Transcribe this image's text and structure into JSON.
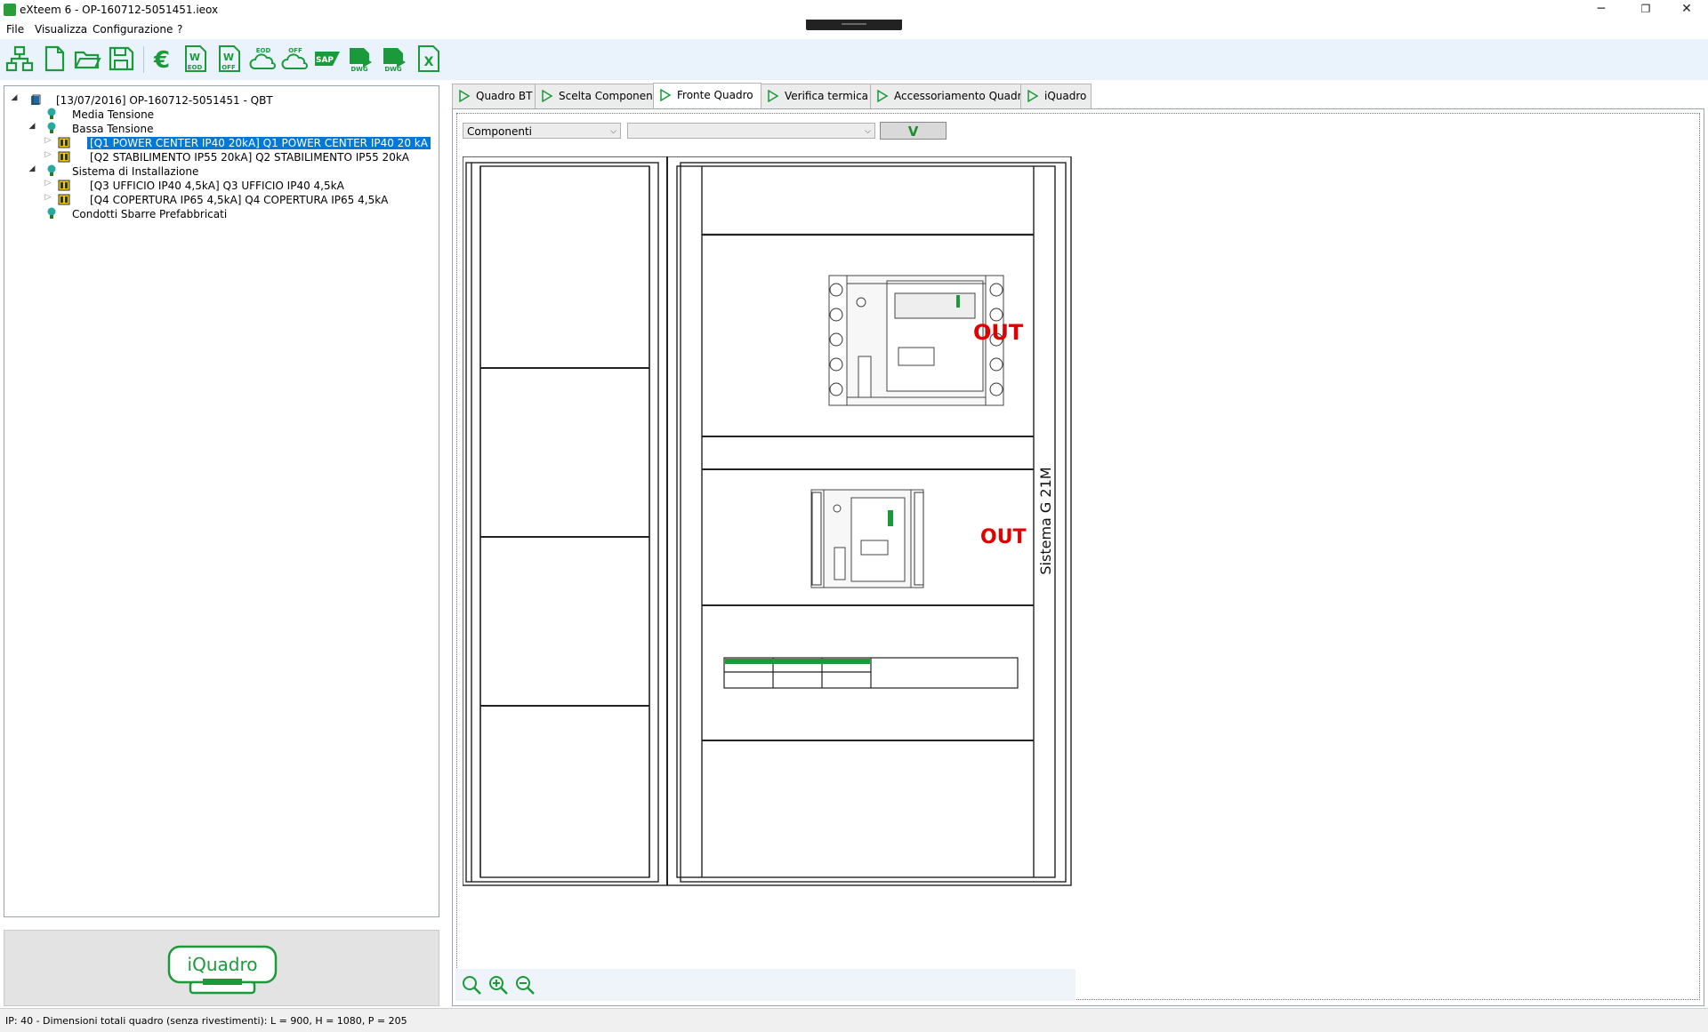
{
  "window": {
    "title": "eXteem 6 - OP-160712-5051451.ieox",
    "controls": {
      "minimize": "─",
      "restore": "❐",
      "close": "✕"
    }
  },
  "menu": {
    "items": [
      "File",
      "Visualizza",
      "Configurazione",
      "?"
    ]
  },
  "toolbar": {
    "buttons": [
      {
        "icon": "structure-icon"
      },
      {
        "icon": "new-document-icon"
      },
      {
        "icon": "open-folder-icon"
      },
      {
        "icon": "save-icon"
      },
      {
        "icon": "euro-icon",
        "text": "€"
      },
      {
        "icon": "word-eod-icon",
        "text": "EOD"
      },
      {
        "icon": "word-off-icon",
        "text": "OFF"
      },
      {
        "icon": "cloud-eod-icon",
        "text": "EOD"
      },
      {
        "icon": "cloud-off-icon",
        "text": "OFF"
      },
      {
        "icon": "sap-icon",
        "text": "SAP"
      },
      {
        "icon": "dwg-export-icon",
        "text": "DWG"
      },
      {
        "icon": "dwg-export-2-icon",
        "text": "DWG"
      },
      {
        "icon": "excel-icon",
        "text": "X"
      }
    ],
    "accent": "#1a9a3a"
  },
  "tree": {
    "root": "[13/07/2016] OP-160712-5051451 - QBT",
    "media_tensione": "Media Tensione",
    "bassa_tensione": "Bassa Tensione",
    "q1": "[Q1 POWER CENTER IP40 20kA] Q1 POWER CENTER IP40 20 kA",
    "q2": "[Q2 STABILIMENTO IP55 20kA] Q2 STABILIMENTO IP55 20kA",
    "sistema": "Sistema di Installazione",
    "q3": "[Q3 UFFICIO IP40 4,5kA] Q3 UFFICIO IP40 4,5kA",
    "q4": "[Q4 COPERTURA IP65 4,5kA] Q4 COPERTURA IP65 4,5kA",
    "condotti": "Condotti Sbarre Prefabbricati"
  },
  "logo": {
    "text": "iQuadro"
  },
  "tabs": [
    "Quadro BT",
    "Scelta Componenti",
    "Fronte Quadro",
    "Verifica termica",
    "Accessoriamento Quadro",
    "iQuadro"
  ],
  "active_tab": "Fronte Quadro",
  "filters": {
    "combo1": "Componenti",
    "combo2": "",
    "apply_label": "V"
  },
  "drawing": {
    "out_label_1": "OUT",
    "out_label_2": "OUT",
    "side_label": "Sistema G 21M",
    "out_color": "#e00000",
    "module_color": "#1a9a3a"
  },
  "zoom": {
    "icons": [
      "zoom-fit-icon",
      "zoom-in-icon",
      "zoom-out-icon"
    ]
  },
  "status": {
    "text": "IP: 40 - Dimensioni totali quadro (senza rivestimenti): L = 900, H = 1080, P = 205"
  }
}
